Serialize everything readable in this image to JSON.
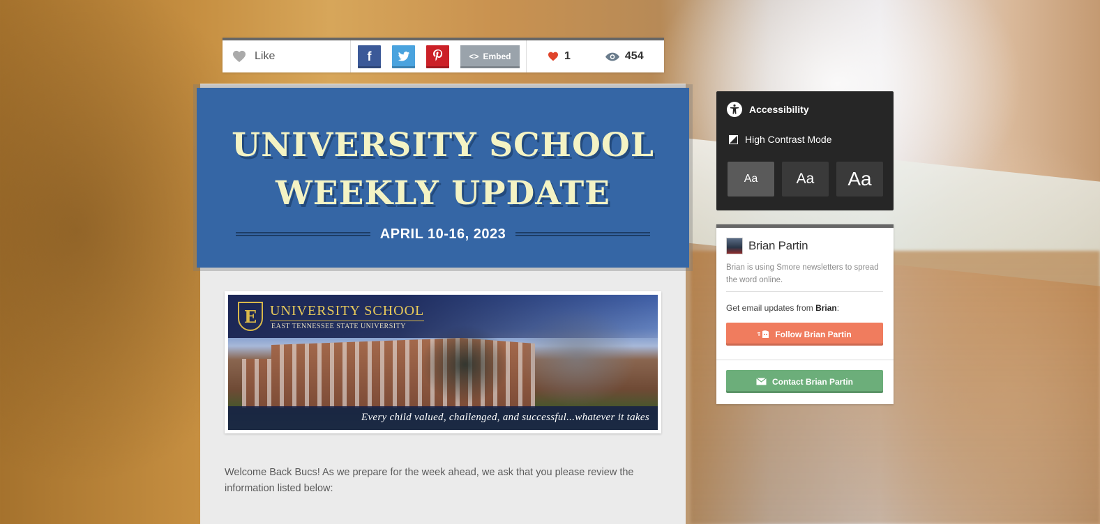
{
  "share_bar": {
    "like_label": "Like",
    "facebook_glyph": "f",
    "embed_label": "Embed",
    "likes_count": "1",
    "views_count": "454"
  },
  "banner": {
    "title_line1": "UNIVERSITY SCHOOL",
    "title_line2": "WEEKLY UPDATE",
    "date": "APRIL 10-16, 2023"
  },
  "photo": {
    "logo_letter": "E",
    "school_name": "UNIVERSITY SCHOOL",
    "university": "EAST TENNESSEE STATE UNIVERSITY",
    "tagline": "Every child valued, challenged, and successful...whatever it takes"
  },
  "body": {
    "welcome": "Welcome Back Bucs! As we prepare for the week ahead, we ask that you please review the information listed below:"
  },
  "accessibility": {
    "title": "Accessibility",
    "high_contrast": "High Contrast Mode",
    "sizes": [
      "Aa",
      "Aa",
      "Aa"
    ]
  },
  "author": {
    "name": "Brian Partin",
    "description": "Brian is using Smore newsletters to spread the word online.",
    "updates_prefix": "Get email updates from ",
    "updates_name": "Brian",
    "updates_suffix": ":",
    "follow_label": "Follow Brian Partin",
    "contact_label": "Contact Brian Partin"
  },
  "colors": {
    "banner_blue": "#3566a5",
    "title_cream": "#f4f3c4",
    "follow_orange": "#f07c5e",
    "contact_green": "#6cae7a",
    "heart_red": "#e0442b"
  },
  "icons": [
    "heart-outline-icon",
    "facebook-icon",
    "twitter-icon",
    "pinterest-icon",
    "code-icon",
    "heart-icon",
    "eye-icon",
    "accessibility-icon",
    "contrast-icon",
    "follow-icon",
    "envelope-icon"
  ]
}
